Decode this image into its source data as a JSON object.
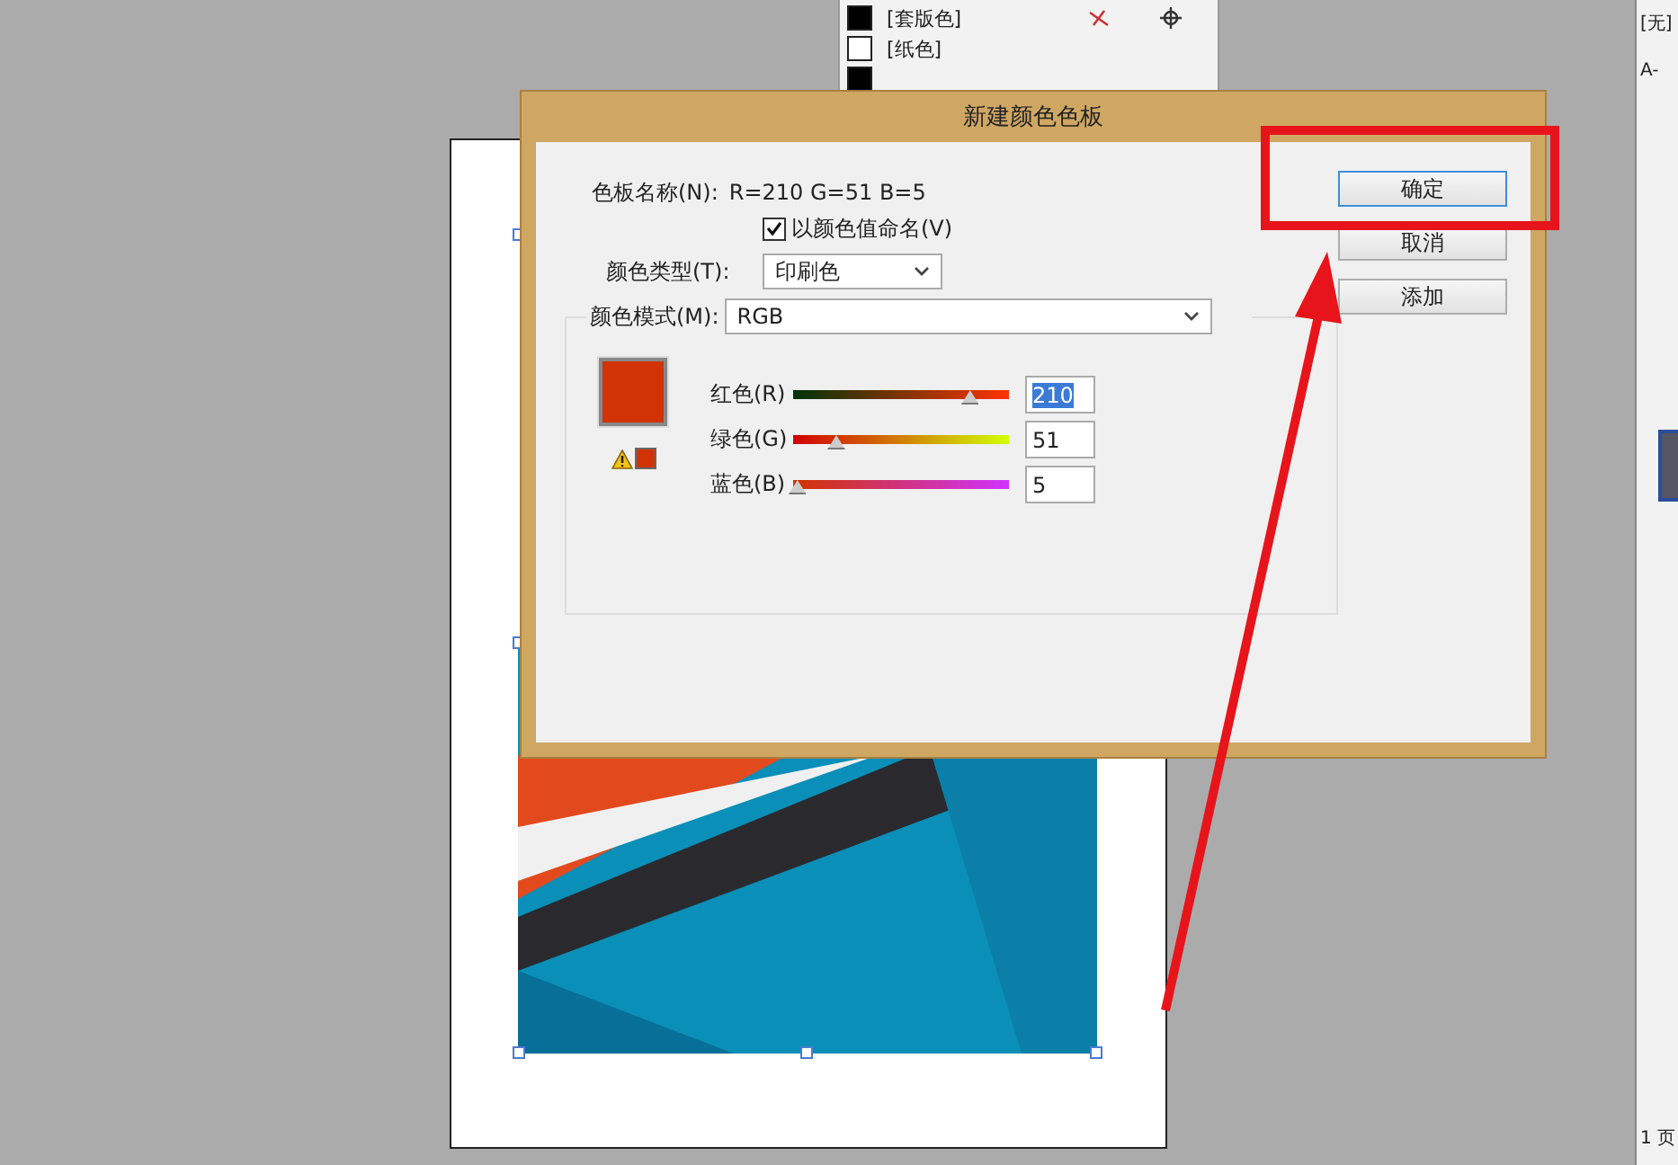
{
  "swatches_panel": {
    "rows": [
      {
        "kind": "registration",
        "name": "[套版色]"
      },
      {
        "kind": "paper",
        "name": "[纸色]"
      },
      {
        "kind": "black"
      }
    ]
  },
  "pages_panel": {
    "none_item": "[无]",
    "master_item": "A-",
    "status": "1 页"
  },
  "dialog": {
    "title": "新建颜色色板",
    "swatch_name_label": "色板名称(N):",
    "swatch_name": "R=210 G=51 B=5",
    "name_with_value": {
      "label": "以颜色值命名(V)",
      "checked": true
    },
    "color_type": {
      "label": "颜色类型(T):",
      "value": "印刷色"
    },
    "color_mode": {
      "label": "颜色模式(M):",
      "value": "RGB"
    },
    "channels": [
      {
        "kind": "red",
        "label": "红色(R)",
        "level": 0.82,
        "value": "210",
        "selected": true
      },
      {
        "kind": "green",
        "label": "绿色(G)",
        "level": 0.2,
        "value": "51",
        "selected": false
      },
      {
        "kind": "blue",
        "label": "蓝色(B)",
        "level": 0.02,
        "value": "5",
        "selected": false
      }
    ],
    "buttons": [
      {
        "label": "确定",
        "default": true
      },
      {
        "label": "取消",
        "default": false
      },
      {
        "label": "添加",
        "default": false
      }
    ]
  }
}
